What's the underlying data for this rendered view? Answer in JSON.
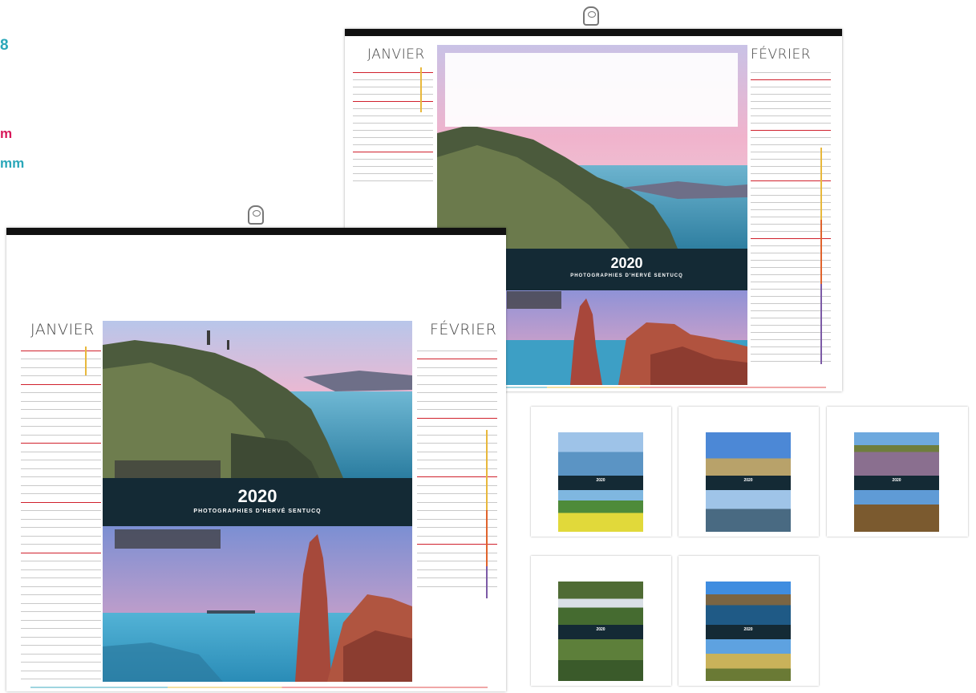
{
  "side_notes": {
    "number": "8",
    "line_m": "m",
    "line_mm": "mm"
  },
  "colors": {
    "teal": "#2aa7b9",
    "magenta": "#d8195a",
    "band": "#142a35",
    "red": "#d0212d"
  },
  "calendar_back": {
    "month_left": "JANVIER",
    "month_right": "FÉVRIER",
    "year": "2020",
    "subtitle": "PHOTOGRAPHIES D'HERVÉ SENTUCQ"
  },
  "calendar_front": {
    "month_left": "JANVIER",
    "month_right": "FÉVRIER",
    "year": "2020",
    "subtitle": "PHOTOGRAPHIES D'HERVÉ SENTUCQ"
  },
  "thumbnails": [
    {
      "year": "2020",
      "icon": "calendar-thumbnail-icon"
    },
    {
      "year": "2020",
      "icon": "calendar-thumbnail-icon"
    },
    {
      "year": "2020",
      "icon": "calendar-thumbnail-icon"
    },
    {
      "year": "2020",
      "icon": "calendar-thumbnail-icon"
    },
    {
      "year": "2020",
      "icon": "calendar-thumbnail-icon"
    }
  ]
}
